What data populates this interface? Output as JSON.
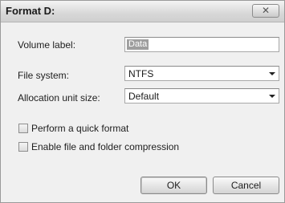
{
  "window": {
    "title": "Format D:",
    "close_glyph": "✕"
  },
  "form": {
    "volume_label": {
      "label": "Volume label:",
      "value": "Data"
    },
    "file_system": {
      "label": "File system:",
      "value": "NTFS"
    },
    "allocation": {
      "label": "Allocation unit size:",
      "value": "Default"
    }
  },
  "options": {
    "quick_format": {
      "label": "Perform a quick format",
      "checked": false
    },
    "compression": {
      "label": "Enable file and folder compression",
      "checked": false
    }
  },
  "buttons": {
    "ok": "OK",
    "cancel": "Cancel"
  }
}
